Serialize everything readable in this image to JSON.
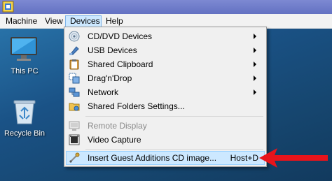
{
  "menubar": {
    "items": [
      {
        "label": "Machine"
      },
      {
        "label": "View"
      },
      {
        "label": "Devices"
      },
      {
        "label": "Help"
      }
    ]
  },
  "desktop": {
    "icons": [
      {
        "label": "This PC",
        "icon": "monitor-icon"
      },
      {
        "label": "Recycle Bin",
        "icon": "recycle-bin-icon"
      }
    ]
  },
  "devices_menu": {
    "items": [
      {
        "label": "CD/DVD Devices",
        "icon": "cd-dvd-icon",
        "submenu": true
      },
      {
        "label": "USB Devices",
        "icon": "usb-icon",
        "submenu": true
      },
      {
        "label": "Shared Clipboard",
        "icon": "clipboard-icon",
        "submenu": true
      },
      {
        "label": "Drag'n'Drop",
        "icon": "drag-drop-icon",
        "submenu": true
      },
      {
        "label": "Network",
        "icon": "network-icon",
        "submenu": true
      },
      {
        "label": "Shared Folders Settings...",
        "icon": "shared-folder-icon",
        "submenu": false
      },
      {
        "label": "Remote Display",
        "icon": "remote-display-icon",
        "submenu": false,
        "disabled": true
      },
      {
        "label": "Video Capture",
        "icon": "video-capture-icon",
        "submenu": false
      },
      {
        "label": "Insert Guest Additions CD image...",
        "icon": "guest-additions-icon",
        "shortcut": "Host+D",
        "highlighted": true
      }
    ]
  },
  "colors": {
    "highlight": "#cce8ff",
    "menu_bg": "#f0f0f0",
    "arrow": "#e8141b"
  }
}
